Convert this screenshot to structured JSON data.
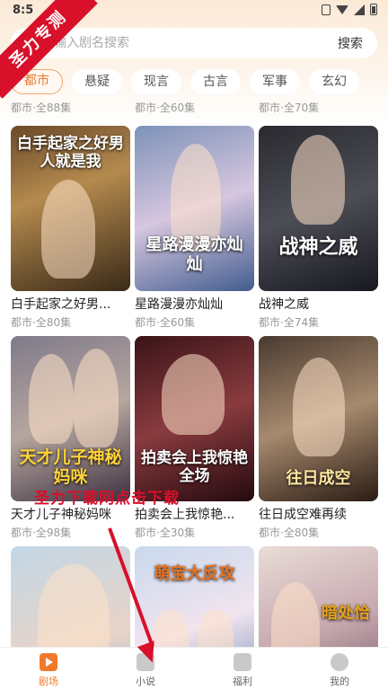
{
  "status": {
    "time": "8:5"
  },
  "watermark": {
    "corner": "圣力专测",
    "overlay": "圣力下载网点击下载"
  },
  "search": {
    "placeholder": "输入剧名搜索",
    "button": "搜索"
  },
  "tabs": [
    "都市",
    "悬疑",
    "现言",
    "古言",
    "军事",
    "玄幻"
  ],
  "previous_row_meta": [
    "都市·全88集",
    "都市·全60集",
    "都市·全70集"
  ],
  "cards": [
    {
      "title": "白手起家之好男...",
      "meta": "都市·全80集",
      "poster_text": "白手起家之好男人就是我"
    },
    {
      "title": "星路漫漫亦灿灿",
      "meta": "都市·全60集",
      "poster_text": "星路漫漫亦灿灿"
    },
    {
      "title": "战神之威",
      "meta": "都市·全74集",
      "poster_text": "战神之威"
    },
    {
      "title": "天才儿子神秘妈咪",
      "meta": "都市·全98集",
      "poster_text": "天才儿子神秘妈咪"
    },
    {
      "title": "拍卖会上我惊艳...",
      "meta": "都市·全30集",
      "poster_text": "拍卖会上我惊艳全场"
    },
    {
      "title": "往日成空难再续",
      "meta": "都市·全80集",
      "poster_text": "往日成空"
    },
    {
      "poster_text": ""
    },
    {
      "poster_text": "萌宝大反攻"
    },
    {
      "poster_text": "暗处恰"
    }
  ],
  "nav": [
    {
      "label": "剧场",
      "icon": "theater-icon"
    },
    {
      "label": "小说",
      "icon": "book-icon"
    },
    {
      "label": "福利",
      "icon": "gift-icon"
    },
    {
      "label": "我的",
      "icon": "profile-icon"
    }
  ],
  "colors": {
    "accent": "#f07a2a",
    "watermark": "#d8102a"
  }
}
